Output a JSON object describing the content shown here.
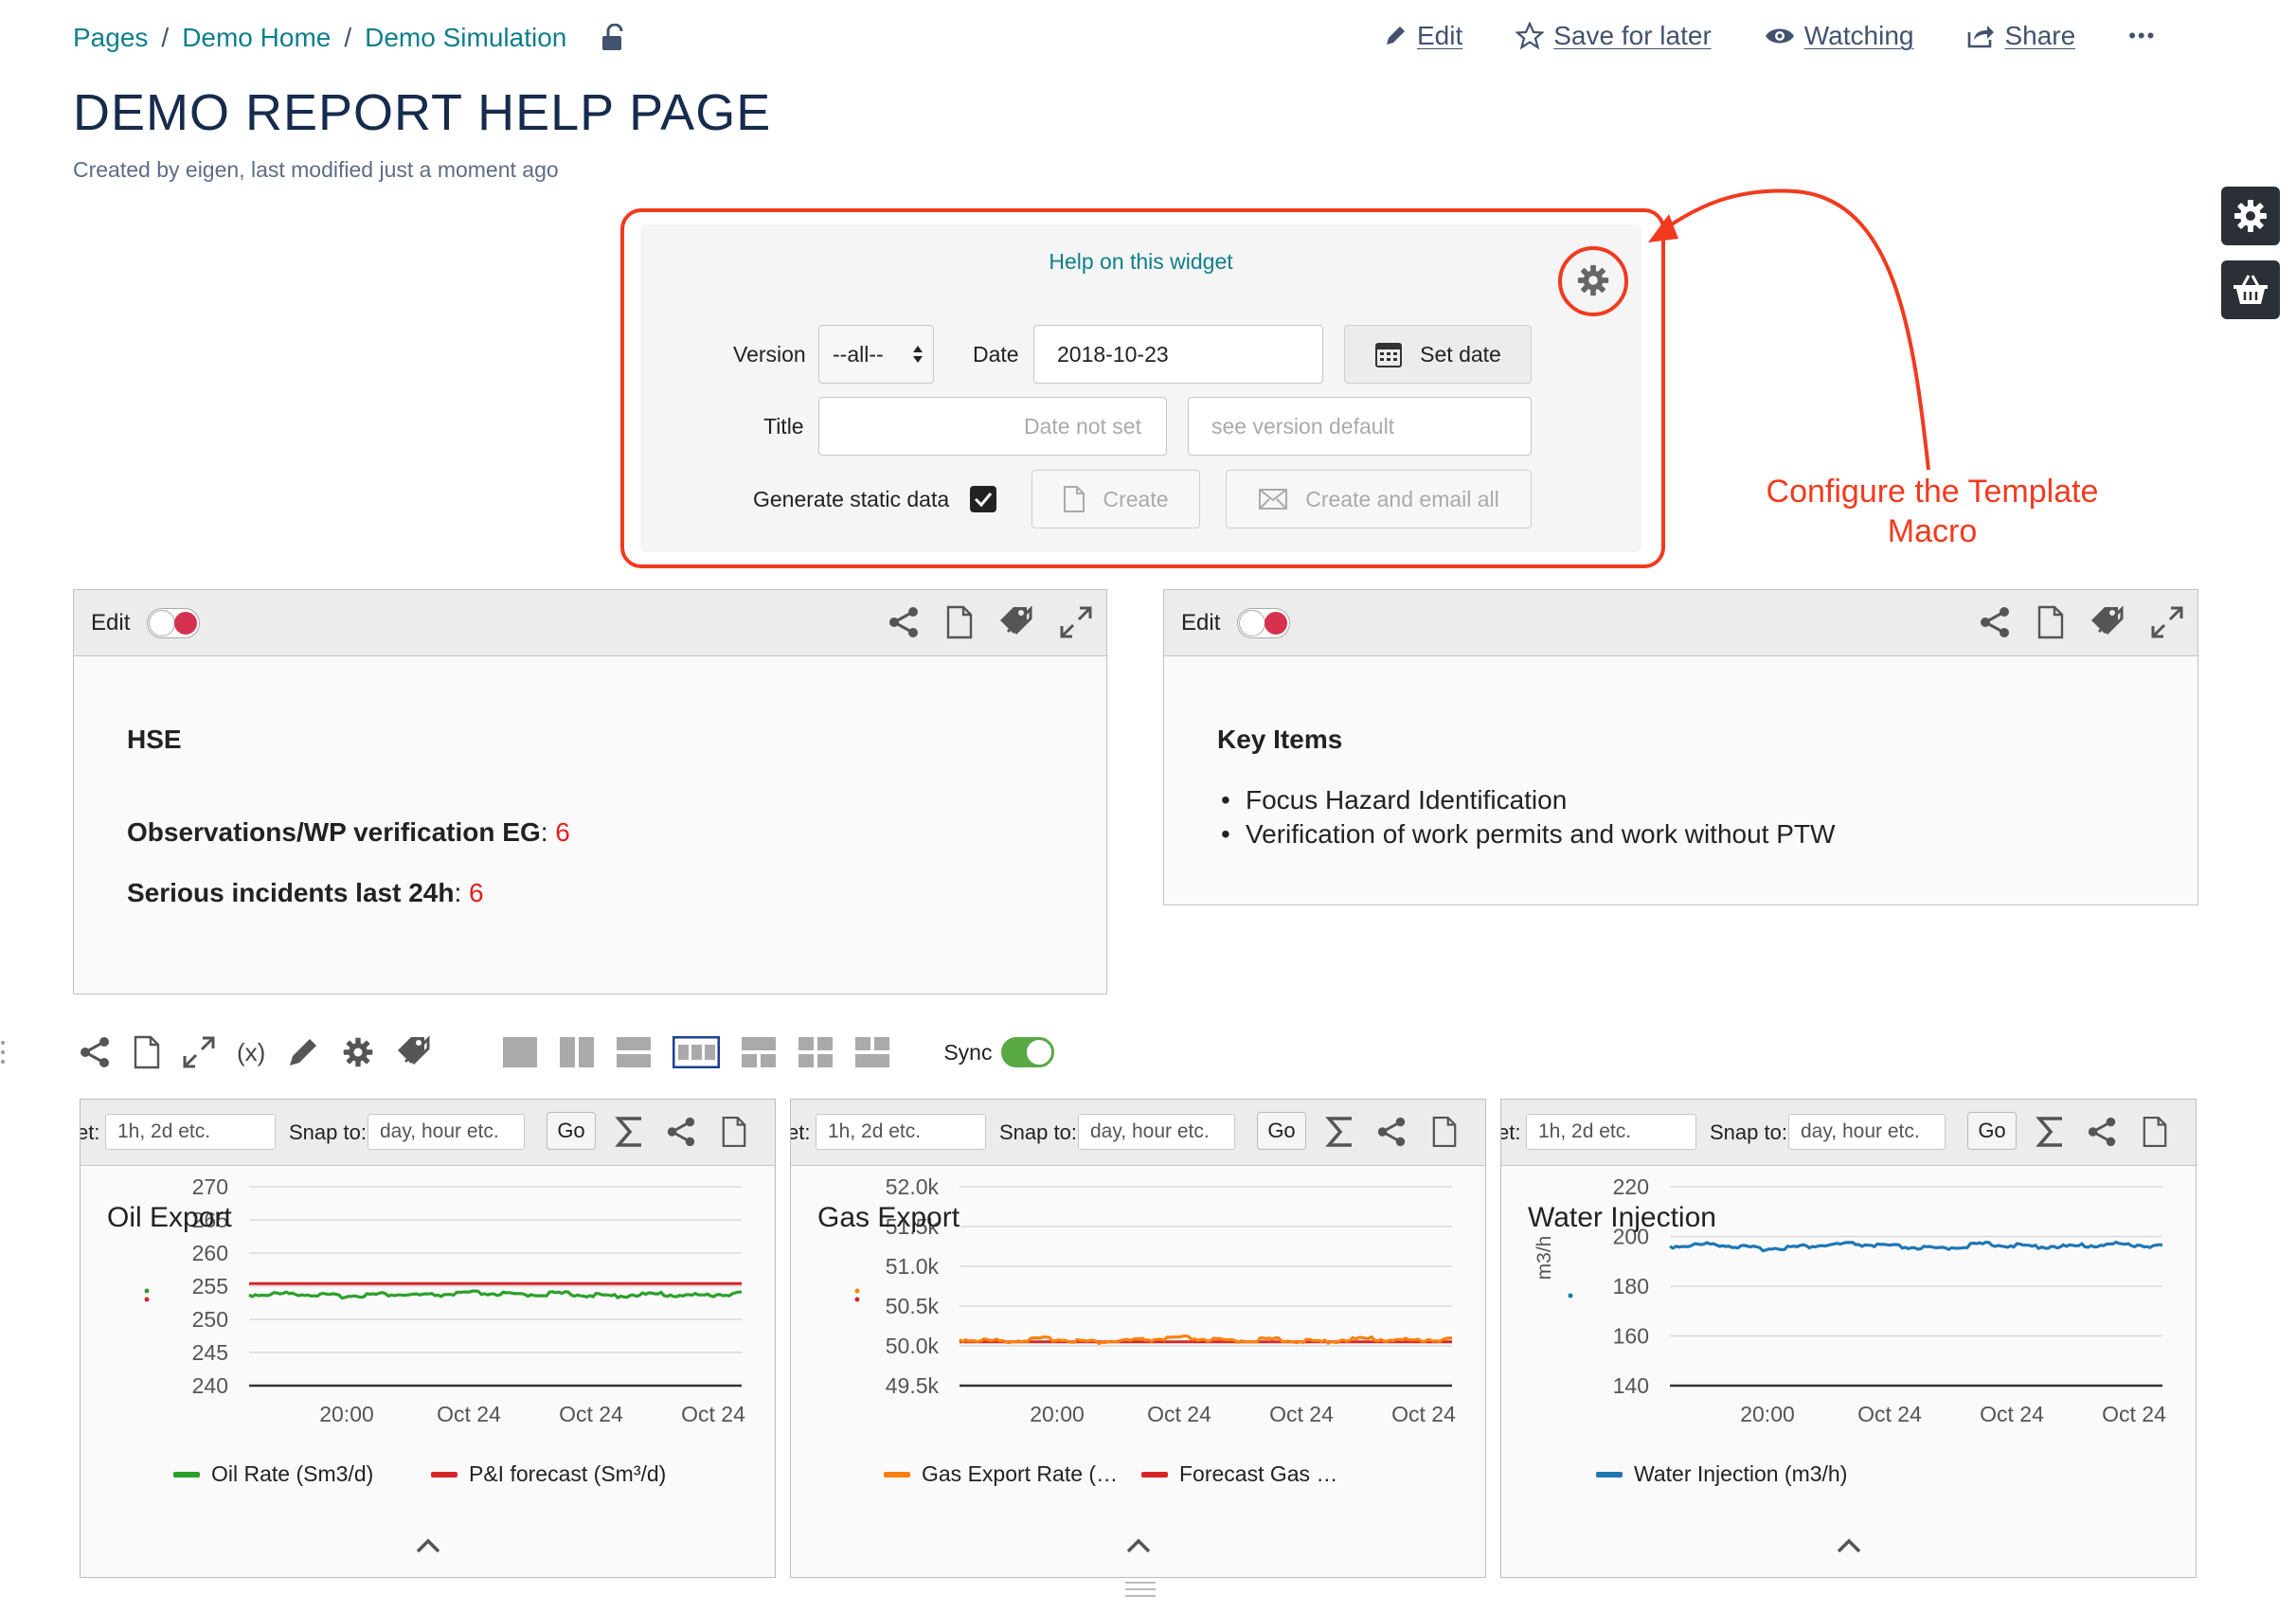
{
  "breadcrumbs": [
    "Pages",
    "Demo Home",
    "Demo Simulation"
  ],
  "breadcrumb_sep": "/",
  "actions": {
    "edit": "Edit",
    "save": "Save for later",
    "watching": "Watching",
    "share": "Share",
    "more": "•••"
  },
  "page": {
    "title": "DEMO REPORT HELP PAGE",
    "byline": "Created by eigen, last modified just a moment ago"
  },
  "widget": {
    "help_link": "Help on this widget",
    "version_label": "Version",
    "version_value": "--all--",
    "date_label": "Date",
    "date_value": "2018-10-23",
    "set_date_button": "Set date",
    "title_label": "Title",
    "title_placeholder": "Date not set",
    "title2_placeholder": "see version default",
    "static_label": "Generate static data",
    "create_button": "Create",
    "create_email_button": "Create and email all"
  },
  "annotation": {
    "line1": "Configure the Template",
    "line2": "Macro"
  },
  "panel_hse": {
    "edit_label": "Edit",
    "heading": "HSE",
    "row1_label": "Observations/WP verification EG",
    "row1_value": "6",
    "row2_label": "Serious incidents last 24h",
    "row2_value": "6",
    "colon": ":"
  },
  "panel_key": {
    "edit_label": "Edit",
    "heading": "Key Items",
    "items": [
      "Focus Hazard Identification",
      "Verification of work permits and work without PTW"
    ]
  },
  "toolbar": {
    "variables_label": "(x)",
    "sync_label": "Sync"
  },
  "chart_controls": {
    "offset_label": "et:",
    "offset_placeholder": "1h, 2d etc.",
    "snap_label": "Snap to:",
    "snap_placeholder": "day, hour etc.",
    "go_label": "Go"
  },
  "colors": {
    "accent": "#0d7f8a",
    "annotation": "#f23a1e",
    "oil": "#2ca02c",
    "forecast": "#d62728",
    "gas": "#ff7f0e",
    "water": "#1f77b4"
  },
  "chart_data": [
    {
      "type": "line",
      "title": "Oil Export",
      "ylabel": "",
      "x_ticks": [
        "20:00",
        "Oct 24",
        "Oct 24",
        "Oct 24"
      ],
      "y_ticks": [
        "270",
        "265",
        "260",
        "255",
        "250",
        "245",
        "240"
      ],
      "ylim": [
        240,
        270
      ],
      "series": [
        {
          "name": "Oil Rate (Sm3/d)",
          "color": "#2ca02c",
          "values": [
            253.7,
            253.9,
            253.5,
            253.8,
            253.6,
            254.0,
            253.7,
            253.9,
            253.5,
            253.8,
            253.6,
            253.9
          ]
        },
        {
          "name": "P&I forecast (Sm³/d)",
          "color": "#d62728",
          "values": [
            255.4,
            255.4,
            255.4,
            255.4,
            255.4,
            255.4,
            255.4,
            255.4,
            255.4,
            255.4,
            255.4,
            255.4
          ]
        }
      ]
    },
    {
      "type": "line",
      "title": "Gas Export",
      "ylabel": "",
      "x_ticks": [
        "20:00",
        "Oct 24",
        "Oct 24",
        "Oct 24"
      ],
      "y_ticks": [
        "52.0k",
        "51.5k",
        "51.0k",
        "50.5k",
        "50.0k",
        "49.5k"
      ],
      "ylim": [
        49500,
        52000
      ],
      "series": [
        {
          "name": "Gas Export Rate (…",
          "color": "#ff7f0e",
          "values": [
            50080,
            50060,
            50090,
            50050,
            50070,
            50100,
            50060,
            50080,
            50050,
            50090,
            50070,
            50080
          ]
        },
        {
          "name": "Forecast Gas …",
          "color": "#d62728",
          "values": [
            50050,
            50050,
            50050,
            50050,
            50050,
            50050,
            50050,
            50050,
            50050,
            50050,
            50050,
            50050
          ]
        }
      ]
    },
    {
      "type": "line",
      "title": "Water Injection",
      "ylabel": "m3/h",
      "x_ticks": [
        "20:00",
        "Oct 24",
        "Oct 24",
        "Oct 24"
      ],
      "y_ticks": [
        "220",
        "200",
        "180",
        "160",
        "140"
      ],
      "ylim": [
        140,
        220
      ],
      "series": [
        {
          "name": "Water Injection (m3/h)",
          "color": "#1f77b4",
          "values": [
            196,
            197,
            195,
            196,
            197,
            196,
            195,
            197,
            196,
            196,
            197,
            196
          ]
        }
      ]
    }
  ]
}
